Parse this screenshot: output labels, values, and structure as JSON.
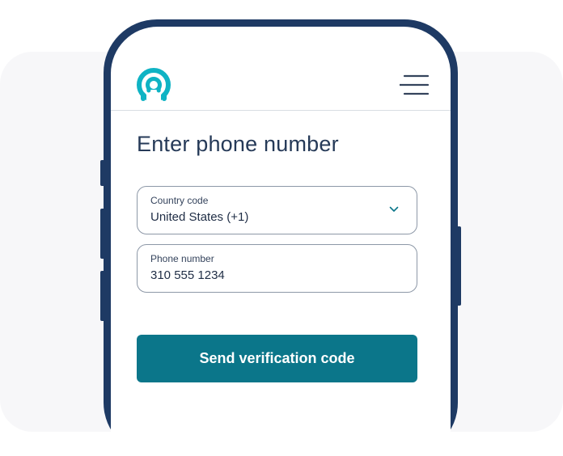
{
  "app": {
    "logo_icon": "signal-ring-logo-icon",
    "menu_icon": "hamburger-menu-icon"
  },
  "page": {
    "title": "Enter phone number"
  },
  "country_field": {
    "label": "Country code",
    "value": "United States (+1)",
    "icon": "chevron-down-icon"
  },
  "phone_field": {
    "label": "Phone number",
    "value": "310 555 1234"
  },
  "actions": {
    "send_label": "Send verification code"
  },
  "colors": {
    "frame": "#1e3a64",
    "accent": "#0b768a",
    "logo": "#0fb3c4",
    "text": "#263a58"
  }
}
